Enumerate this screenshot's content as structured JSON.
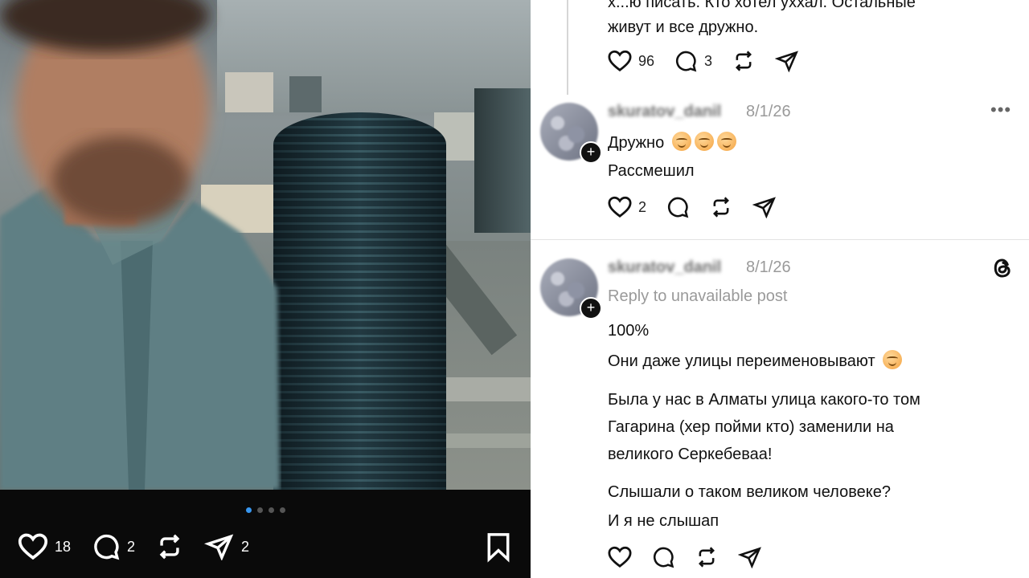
{
  "left_post": {
    "likes": "18",
    "comments": "2",
    "shares": "2",
    "carousel_total": 4,
    "carousel_active": 1
  },
  "thread": {
    "top_text_partial": "х...ю писать. Кто хотел уххал. Остальные",
    "top_text_line2": "живут и все дружно.",
    "top_likes": "96",
    "top_comments": "3"
  },
  "comments": [
    {
      "username": "skuratov_danil",
      "date": "8/1/26",
      "line1": "Дружно",
      "line2": "Рассмешил",
      "likes": "2"
    },
    {
      "username": "skuratov_danil",
      "date": "8/1/26",
      "reply_note": "Reply to unavailable post",
      "p1": "100%",
      "p2": "Они даже улицы переименовывают",
      "p3_l1": "Была у нас в Алматы улица какого-то том",
      "p3_l2": "Гагарина (хер пойми кто) заменили на",
      "p3_l3": "великого Серкебеваа!",
      "p4_l1": "Слышали о таком великом человеке?",
      "p4_l2": "И я не слышап"
    }
  ],
  "icons": {
    "more": "more-icon",
    "threads_logo": "threads-logo-icon"
  }
}
